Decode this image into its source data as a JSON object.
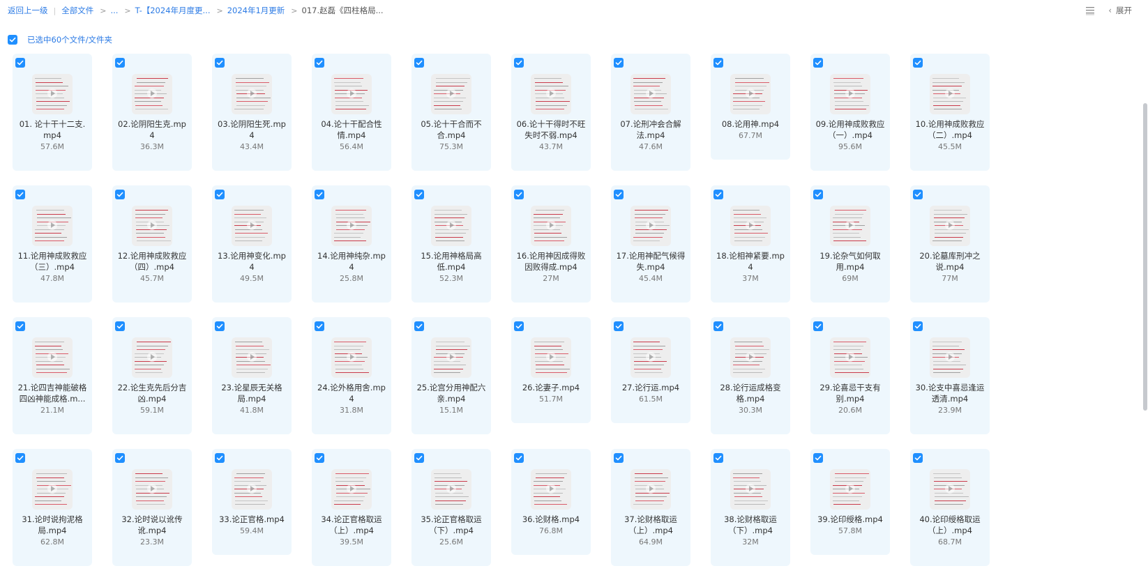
{
  "breadcrumb": {
    "back": "返回上一级",
    "all_files": "全部文件",
    "ellipsis": "...",
    "level1": "T-【2024年月度更...",
    "level2": "2024年1月更新",
    "current": "017.赵磊《四柱格局..."
  },
  "toolbar": {
    "expand_label": "展开",
    "list_view_icon": "list-view-icon"
  },
  "selection": {
    "label": "已选中60个文件/文件夹"
  },
  "colors": {
    "accent": "#1f8fff",
    "card_bg": "#eef7fd",
    "link": "#2c7be5"
  },
  "files": [
    {
      "name": "01. 论十干十二支.mp4",
      "size": "57.6M"
    },
    {
      "name": "02.论阴阳生克.mp4",
      "size": "36.3M"
    },
    {
      "name": "03.论阴阳生死.mp4",
      "size": "43.4M"
    },
    {
      "name": "04.论十干配合性情.mp4",
      "size": "56.4M"
    },
    {
      "name": "05.论十干合而不合.mp4",
      "size": "75.3M"
    },
    {
      "name": "06.论十干得时不旺失时不弱.mp4",
      "size": "43.7M"
    },
    {
      "name": "07.论刑冲会合解法.mp4",
      "size": "47.6M"
    },
    {
      "name": "08.论用神.mp4",
      "size": "67.7M"
    },
    {
      "name": "09.论用神成败救应（一）.mp4",
      "size": "95.6M"
    },
    {
      "name": "10.论用神成败救应（二）.mp4",
      "size": "45.5M"
    },
    {
      "name": "11.论用神成败救应（三）.mp4",
      "size": "47.8M"
    },
    {
      "name": "12.论用神成败救应（四）.mp4",
      "size": "45.7M"
    },
    {
      "name": "13.论用神变化.mp4",
      "size": "49.5M"
    },
    {
      "name": "14.论用神纯杂.mp4",
      "size": "25.8M"
    },
    {
      "name": "15.论用神格局高低.mp4",
      "size": "52.3M"
    },
    {
      "name": "16.论用神因成得败因败得成.mp4",
      "size": "27M"
    },
    {
      "name": "17.论用神配气候得失.mp4",
      "size": "45.4M"
    },
    {
      "name": "18.论相神紧要.mp4",
      "size": "37M"
    },
    {
      "name": "19.论杂气如何取用.mp4",
      "size": "69M"
    },
    {
      "name": "20.论墓库刑冲之说.mp4",
      "size": "77M"
    },
    {
      "name": "21.论四吉神能破格四凶神能成格.m...",
      "size": "21.1M"
    },
    {
      "name": "22.论生克先后分吉凶.mp4",
      "size": "59.1M"
    },
    {
      "name": "23.论星辰无关格局.mp4",
      "size": "41.8M"
    },
    {
      "name": "24.论外格用舍.mp4",
      "size": "31.8M"
    },
    {
      "name": "25.论宫分用神配六亲.mp4",
      "size": "15.1M"
    },
    {
      "name": "26.论妻子.mp4",
      "size": "51.7M"
    },
    {
      "name": "27.论行运.mp4",
      "size": "61.5M"
    },
    {
      "name": "28.论行运成格变格.mp4",
      "size": "30.3M"
    },
    {
      "name": "29.论喜忌干支有别.mp4",
      "size": "20.6M"
    },
    {
      "name": "30.论支中喜忌逢运透清.mp4",
      "size": "23.9M"
    },
    {
      "name": "31.论时说拘泥格局.mp4",
      "size": "62.8M"
    },
    {
      "name": "32.论时说以讹传讹.mp4",
      "size": "23.3M"
    },
    {
      "name": "33.论正官格.mp4",
      "size": "59.4M"
    },
    {
      "name": "34.论正官格取运（上）.mp4",
      "size": "39.5M"
    },
    {
      "name": "35.论正官格取运（下）.mp4",
      "size": "25.6M"
    },
    {
      "name": "36.论财格.mp4",
      "size": "76.8M"
    },
    {
      "name": "37.论财格取运（上）.mp4",
      "size": "64.9M"
    },
    {
      "name": "38.论财格取运（下）.mp4",
      "size": "32M"
    },
    {
      "name": "39.论印绶格.mp4",
      "size": "57.8M"
    },
    {
      "name": "40.论印绶格取运（上）.mp4",
      "size": "68.7M"
    }
  ]
}
